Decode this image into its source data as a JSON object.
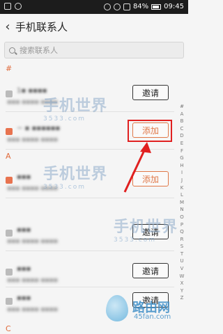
{
  "status": {
    "battery": "84%",
    "time": "09:45"
  },
  "header": {
    "back_glyph": "‹",
    "title": "手机联系人"
  },
  "search": {
    "placeholder": "搜索联系人"
  },
  "sections": [
    {
      "label": "#"
    },
    {
      "label": "A"
    },
    {
      "label": "C"
    }
  ],
  "contacts": [
    {
      "name": "1▪ ▪▪▪▪",
      "number": "▪▪▪ ▪▪▪▪ ▪▪▪▪",
      "action": "邀请"
    },
    {
      "name": "~  ▪ ▪▪▪▪▪▪",
      "number": "▪▪▪ ▪▪▪▪ ▪▪▪▪",
      "action": "添加"
    },
    {
      "name": "▪▪▪",
      "number": "▪▪▪ ▪▪▪▪ ▪▪▪▪",
      "action": "添加"
    },
    {
      "name": "▪▪▪",
      "number": "▪▪▪ ▪▪▪▪ ▪▪▪▪",
      "action": "邀请"
    },
    {
      "name": "▪▪▪",
      "number": "▪▪▪ ▪▪▪▪ ▪▪▪▪",
      "action": "邀请"
    },
    {
      "name": "▪▪▪",
      "number": "▪▪▪ ▪▪▪▪ ▪▪▪▪",
      "action": "邀请"
    }
  ],
  "index_letters": [
    "#",
    "A",
    "B",
    "C",
    "D",
    "E",
    "F",
    "G",
    "H",
    "I",
    "J",
    "K",
    "L",
    "M",
    "N",
    "O",
    "P",
    "Q",
    "R",
    "S",
    "T",
    "U",
    "V",
    "W",
    "X",
    "Y",
    "Z"
  ],
  "watermarks": {
    "main": "手机世界",
    "sub": "3533.com"
  },
  "logo": {
    "name": "路由网",
    "domain": "45fan.com"
  },
  "colors": {
    "accent": "#e07848",
    "highlight": "#e02020"
  }
}
